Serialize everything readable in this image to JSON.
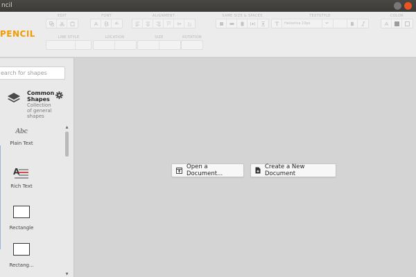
{
  "window": {
    "title": "ncil"
  },
  "brand": "PENCIL",
  "toolbar": {
    "groups": {
      "edit": "EDIT",
      "font": "FONT",
      "alignment": "ALIGNMENT",
      "same_size": "SAME SIZE & SPACES",
      "textstyle": "TEXTSTYLE",
      "color": "COLOR",
      "line_style": "LINE STYLE",
      "location": "LOCATION",
      "size": "SIZE",
      "rotation": "ROTATION"
    },
    "font_family_value": "Helvetica 10px"
  },
  "sidebar": {
    "search_placeholder": "earch for shapes",
    "collection": {
      "name": "Common Shapes",
      "description": "Collection of general shapes"
    },
    "shapes": [
      {
        "preview": "Abc",
        "label": "Plain Text"
      },
      {
        "preview": "A",
        "label": "Rich Text"
      },
      {
        "label": "Rectangle"
      },
      {
        "label": "Rectang..."
      }
    ]
  },
  "canvas": {
    "open_label": "Open a Document...",
    "create_label": "Create a New Document"
  },
  "colors": {
    "brand": "#f29c00",
    "titlebar": "#3c3b37",
    "close": "#e95420"
  }
}
